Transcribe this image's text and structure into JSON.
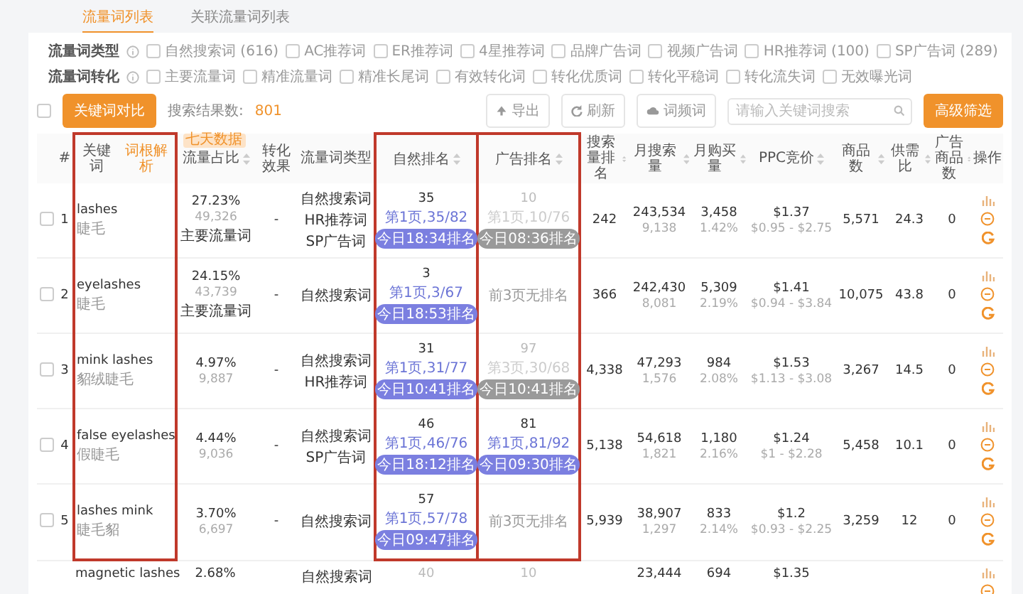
{
  "tabs": [
    {
      "label": "流量词列表",
      "selected": true
    },
    {
      "label": "关联流量词列表",
      "selected": false
    }
  ],
  "filters": [
    {
      "label": "流量词类型",
      "options": [
        {
          "label": "自然搜索词 (616)",
          "checked": false
        },
        {
          "label": "AC推荐词",
          "checked": false
        },
        {
          "label": "ER推荐词",
          "checked": false
        },
        {
          "label": "4星推荐词",
          "checked": false
        },
        {
          "label": "品牌广告词",
          "checked": false
        },
        {
          "label": "视频广告词",
          "checked": false
        },
        {
          "label": "HR推荐词 (100)",
          "checked": false
        },
        {
          "label": "SP广告词 (289)",
          "checked": false
        }
      ]
    },
    {
      "label": "流量词转化",
      "options": [
        {
          "label": "主要流量词",
          "checked": false
        },
        {
          "label": "精准流量词",
          "checked": false
        },
        {
          "label": "精准长尾词",
          "checked": false
        },
        {
          "label": "有效转化词",
          "checked": false
        },
        {
          "label": "转化优质词",
          "checked": false
        },
        {
          "label": "转化平稳词",
          "checked": false
        },
        {
          "label": "转化流失词",
          "checked": false
        },
        {
          "label": "无效曝光词",
          "checked": false
        }
      ]
    }
  ],
  "toolbar": {
    "select_all": {
      "checked": false
    },
    "compare_button": "关键词对比",
    "result_label": "搜索结果数:",
    "result_count": "801",
    "actions": [
      {
        "kind": "export",
        "label": "导出"
      },
      {
        "kind": "refresh",
        "label": "刷新"
      },
      {
        "kind": "cloud",
        "label": "词频词"
      }
    ],
    "search": {
      "placeholder": "请输入关键词搜索"
    },
    "filter_button": "高级筛选"
  },
  "table": {
    "columns": [
      {
        "kind": "check"
      },
      {
        "kind": "plain",
        "label": "#",
        "highlighted": false
      },
      {
        "kind": "keyword",
        "label": "关键词",
        "extra": "词根解析",
        "highlighted": true
      },
      {
        "kind": "sort",
        "label": "流量占比",
        "badge": "七天数据",
        "highlighted": false
      },
      {
        "kind": "plain",
        "label": "转化效果",
        "highlighted": false
      },
      {
        "kind": "plain",
        "label": "流量词类型",
        "highlighted": false
      },
      {
        "kind": "sort",
        "label": "自然排名",
        "highlighted": true
      },
      {
        "kind": "sort",
        "label": "广告排名",
        "highlighted": true
      },
      {
        "kind": "sort",
        "label": "搜索量排名",
        "highlighted": false
      },
      {
        "kind": "sort",
        "label": "月搜索量",
        "highlighted": false
      },
      {
        "kind": "sort",
        "label": "月购买量",
        "highlighted": false
      },
      {
        "kind": "sort",
        "label": "PPC竞价",
        "highlighted": false
      },
      {
        "kind": "sort",
        "label": "商品数",
        "highlighted": false
      },
      {
        "kind": "sort",
        "label": "供需比",
        "highlighted": false
      },
      {
        "kind": "sort",
        "label": "广告商品数",
        "highlighted": false
      },
      {
        "kind": "plain",
        "label": "操作",
        "highlighted": false
      }
    ],
    "rows": [
      {
        "selected": false,
        "highlighted": true,
        "index": "1",
        "keyword": "lashes",
        "translation": "睫毛",
        "share": "27.23%",
        "share_count": "49,326",
        "tag": "主要流量词",
        "conversion": "-",
        "types": [
          "自然搜索词",
          "HR推荐词",
          "SP广告词"
        ],
        "natural": {
          "kind": "ranked",
          "rank": "35",
          "page": "第1页,35/82",
          "time": "今日18:34排名",
          "current": true
        },
        "ad": {
          "kind": "ranked",
          "rank": "10",
          "page": "第1页,10/76",
          "time": "今日08:36排名",
          "current": false
        },
        "search_rank": "242",
        "monthly_searches": "243,534",
        "monthly_searches_sub": "9,138",
        "monthly_purchases": "3,458",
        "purchase_rate": "1.42%",
        "ppc": "$1.37",
        "ppc_range": "$0.95 - $2.75",
        "products": "5,571",
        "supply_demand": "24.3",
        "ad_products": "0"
      },
      {
        "selected": false,
        "highlighted": true,
        "index": "2",
        "keyword": "eyelashes",
        "translation": "睫毛",
        "share": "24.15%",
        "share_count": "43,739",
        "tag": "主要流量词",
        "conversion": "-",
        "types": [
          "自然搜索词"
        ],
        "natural": {
          "kind": "ranked",
          "rank": "3",
          "page": "第1页,3/67",
          "time": "今日18:53排名",
          "current": true
        },
        "ad": {
          "kind": "none",
          "note": "前3页无排名"
        },
        "search_rank": "366",
        "monthly_searches": "242,430",
        "monthly_searches_sub": "8,081",
        "monthly_purchases": "5,309",
        "purchase_rate": "2.19%",
        "ppc": "$1.41",
        "ppc_range": "$0.94 - $3.84",
        "products": "10,075",
        "supply_demand": "43.8",
        "ad_products": "0"
      },
      {
        "selected": false,
        "highlighted": true,
        "index": "3",
        "keyword": "mink lashes",
        "translation": "貂绒睫毛",
        "share": "4.97%",
        "share_count": "9,887",
        "conversion": "-",
        "types": [
          "自然搜索词",
          "HR推荐词"
        ],
        "natural": {
          "kind": "ranked",
          "rank": "31",
          "page": "第1页,31/77",
          "time": "今日10:41排名",
          "current": true
        },
        "ad": {
          "kind": "ranked",
          "rank": "97",
          "page": "第3页,30/68",
          "time": "今日10:41排名",
          "current": false
        },
        "search_rank": "4,338",
        "monthly_searches": "47,293",
        "monthly_searches_sub": "1,576",
        "monthly_purchases": "984",
        "purchase_rate": "2.08%",
        "ppc": "$1.53",
        "ppc_range": "$1.13 - $3.08",
        "products": "3,267",
        "supply_demand": "14.5",
        "ad_products": "0"
      },
      {
        "selected": false,
        "highlighted": true,
        "index": "4",
        "keyword": "false eyelashes",
        "translation": "假睫毛",
        "share": "4.44%",
        "share_count": "9,036",
        "conversion": "-",
        "types": [
          "自然搜索词",
          "SP广告词"
        ],
        "natural": {
          "kind": "ranked",
          "rank": "46",
          "page": "第1页,46/76",
          "time": "今日18:12排名",
          "current": true
        },
        "ad": {
          "kind": "ranked",
          "rank": "81",
          "page": "第1页,81/92",
          "time": "今日09:30排名",
          "current": true
        },
        "search_rank": "5,138",
        "monthly_searches": "54,618",
        "monthly_searches_sub": "1,821",
        "monthly_purchases": "1,180",
        "purchase_rate": "2.16%",
        "ppc": "$1.24",
        "ppc_range": "$1 - $2.28",
        "products": "5,458",
        "supply_demand": "10.1",
        "ad_products": "0"
      },
      {
        "selected": false,
        "highlighted": true,
        "index": "5",
        "keyword": "lashes mink",
        "translation": "睫毛貂",
        "share": "3.70%",
        "share_count": "6,697",
        "conversion": "-",
        "types": [
          "自然搜索词"
        ],
        "natural": {
          "kind": "ranked",
          "rank": "57",
          "page": "第1页,57/78",
          "time": "今日09:47排名",
          "current": true
        },
        "ad": {
          "kind": "none",
          "note": "前3页无排名"
        },
        "search_rank": "5,939",
        "monthly_searches": "38,907",
        "monthly_searches_sub": "1,297",
        "monthly_purchases": "833",
        "purchase_rate": "2.14%",
        "ppc": "$1.2",
        "ppc_range": "$0.93 - $2.25",
        "products": "3,259",
        "supply_demand": "12",
        "ad_products": "0"
      },
      {
        "highlighted": false,
        "keyword": "magnetic lashes",
        "share": "2.68%",
        "types": [
          "自然搜索词"
        ],
        "natural": {
          "kind": "ranked",
          "rank": "40",
          "current": false
        },
        "ad": {
          "kind": "ranked",
          "rank": "10",
          "current": false
        },
        "monthly_searches": "23,444",
        "monthly_purchases": "694",
        "ppc": "$1.35"
      }
    ]
  }
}
